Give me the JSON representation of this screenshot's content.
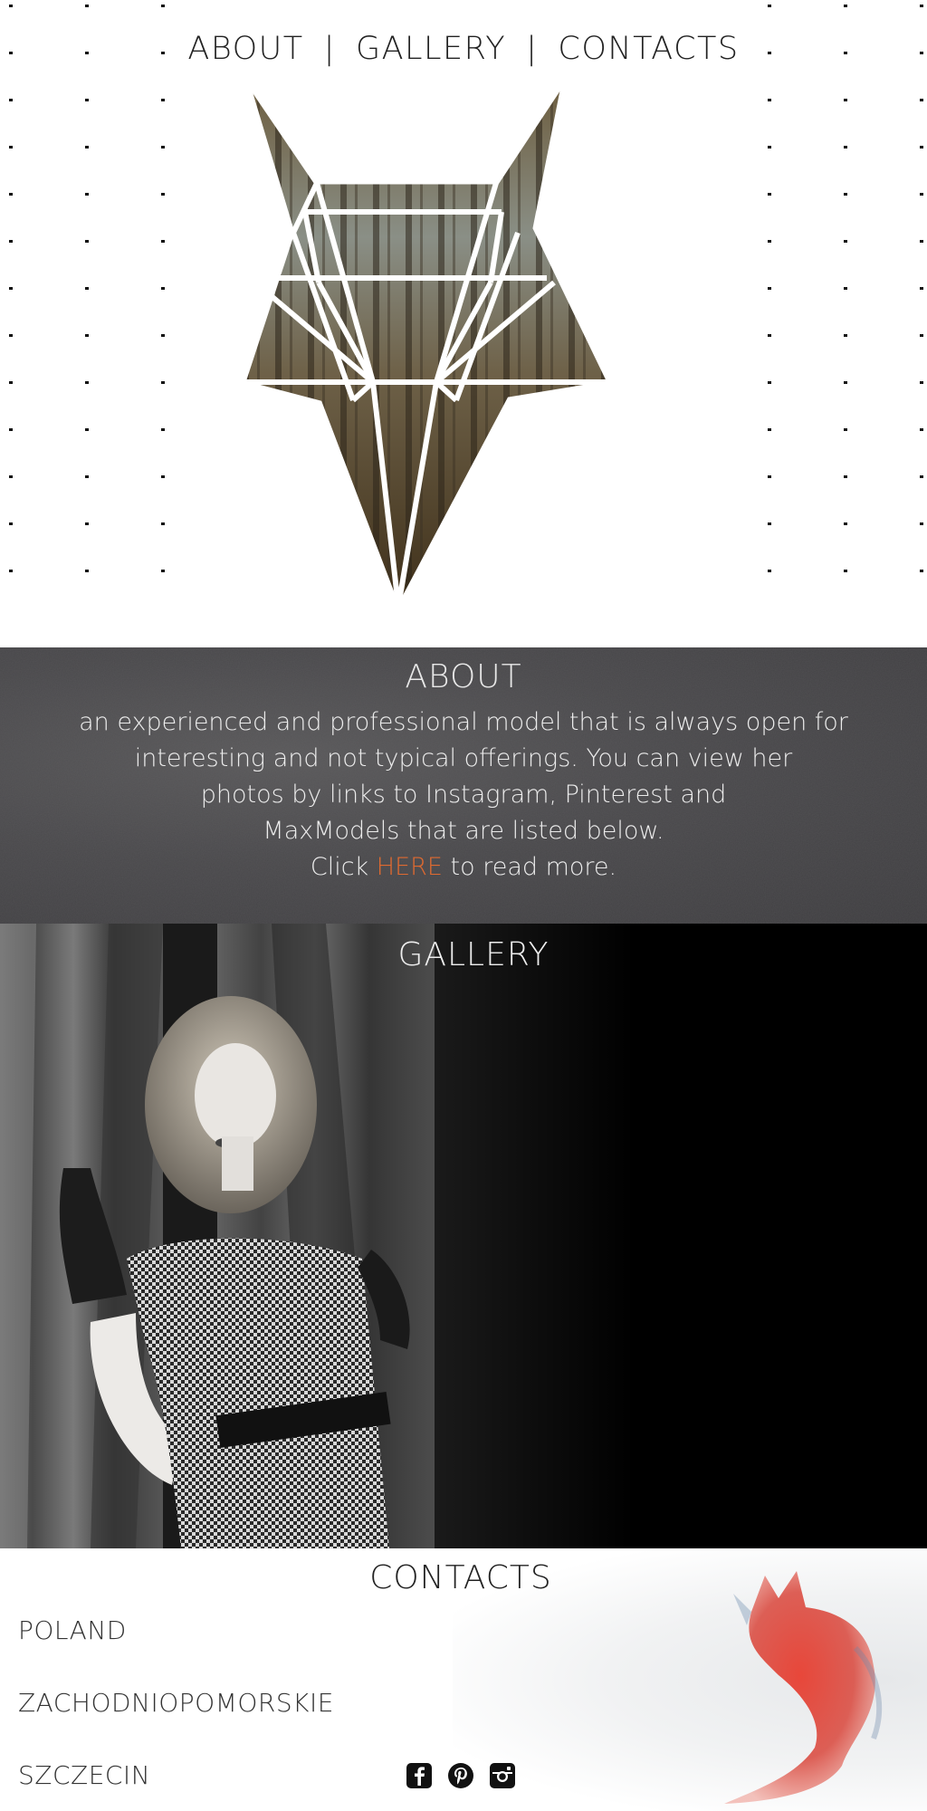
{
  "nav": {
    "items": [
      {
        "label": "ABOUT"
      },
      {
        "label": "GALLERY"
      },
      {
        "label": "CONTACTS"
      }
    ],
    "separator": "|"
  },
  "about": {
    "title": "ABOUT",
    "lines": [
      "an experienced and professional model that is always open for",
      "interesting and not typical offerings. You can view her",
      "photos by links to Instagram, Pinterest and",
      "MaxModels that are listed below."
    ],
    "cta_prefix": "Click ",
    "cta_link": "HERE",
    "cta_suffix": " to read more.",
    "link_color": "#e06a30"
  },
  "gallery": {
    "title": "GALLERY"
  },
  "contacts": {
    "title": "CONTACTS",
    "country": "POLAND",
    "region": "ZACHODNIOPOMORSKIE",
    "city": "SZCZECIN",
    "social": [
      {
        "icon": "facebook-icon"
      },
      {
        "icon": "pinterest-icon"
      },
      {
        "icon": "instagram-icon"
      }
    ]
  }
}
